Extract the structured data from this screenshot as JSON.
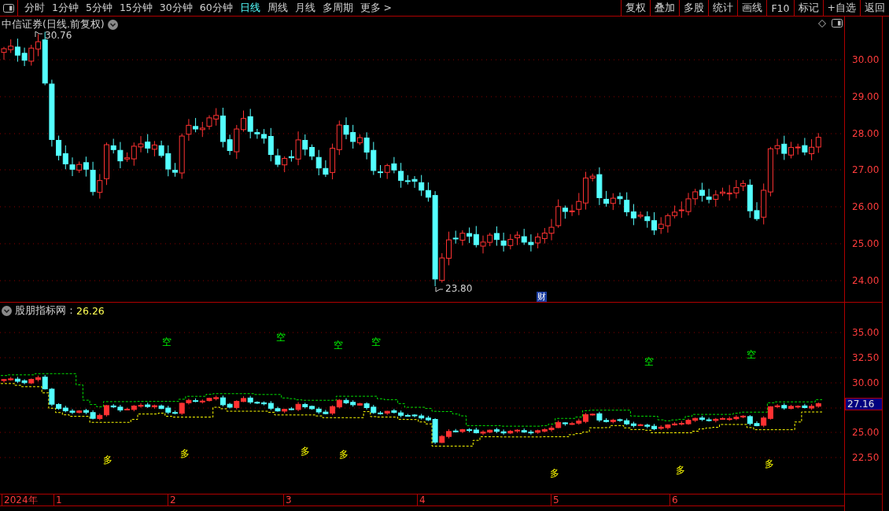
{
  "toolbar": {
    "periods": [
      {
        "label": "分时",
        "selected": false
      },
      {
        "label": "1分钟",
        "selected": false
      },
      {
        "label": "5分钟",
        "selected": false
      },
      {
        "label": "15分钟",
        "selected": false
      },
      {
        "label": "30分钟",
        "selected": false
      },
      {
        "label": "60分钟",
        "selected": false
      },
      {
        "label": "日线",
        "selected": true
      },
      {
        "label": "周线",
        "selected": false
      },
      {
        "label": "月线",
        "selected": false
      },
      {
        "label": "多周期",
        "selected": false
      },
      {
        "label": "更多 >",
        "selected": false
      }
    ],
    "buttons": [
      "复权",
      "叠加",
      "多股",
      "统计",
      "画线",
      "F10",
      "标记",
      "+自选",
      "返回"
    ]
  },
  "price_panel": {
    "title": "中信证券(日线.前复权)",
    "high_label": "30.76",
    "low_label": "23.80",
    "event_badge": "财",
    "axis_labels": [
      "30.00",
      "29.00",
      "28.00",
      "27.00",
      "26.00",
      "25.00",
      "24.00"
    ]
  },
  "indicator_panel": {
    "name": "股朋指标网：",
    "value": "26.26",
    "axis_labels": [
      "35.00",
      "32.50",
      "30.00",
      "25.00",
      "22.50"
    ],
    "current_price": "27.16",
    "signals": [
      {
        "label": "多",
        "kind": "long"
      },
      {
        "label": "空",
        "kind": "short"
      },
      {
        "label": "多",
        "kind": "long"
      },
      {
        "label": "空",
        "kind": "short"
      },
      {
        "label": "多",
        "kind": "long"
      },
      {
        "label": "空",
        "kind": "short"
      },
      {
        "label": "多",
        "kind": "long"
      },
      {
        "label": "空",
        "kind": "short"
      },
      {
        "label": "多",
        "kind": "long"
      },
      {
        "label": "空",
        "kind": "short"
      },
      {
        "label": "多",
        "kind": "long"
      },
      {
        "label": "空",
        "kind": "short"
      },
      {
        "label": "多",
        "kind": "long"
      }
    ]
  },
  "time_axis": [
    "2024年",
    "1",
    "2",
    "3",
    "4",
    "5",
    "6"
  ]
}
